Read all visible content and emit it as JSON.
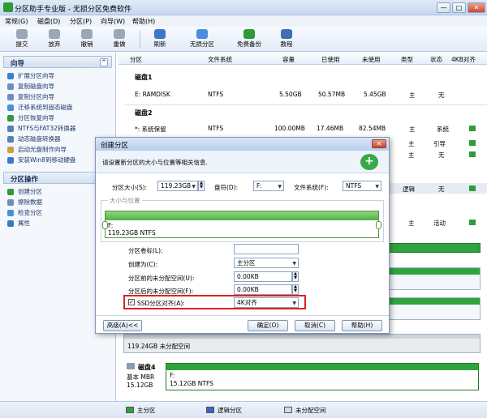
{
  "window": {
    "title": "分区助手专业版 - 无损分区免费软件",
    "min": "—",
    "max": "□",
    "close": "✕"
  },
  "menu": [
    "常规(G)",
    "磁盘(D)",
    "分区(P)",
    "向导(W)",
    "帮助(H)"
  ],
  "toolbar": [
    {
      "label": "提交",
      "icon": "commit-icon"
    },
    {
      "label": "放弃",
      "icon": "discard-icon"
    },
    {
      "label": "撤销",
      "icon": "undo-icon"
    },
    {
      "label": "重做",
      "icon": "redo-icon"
    },
    {
      "label": "刷新",
      "icon": "refresh-icon"
    },
    {
      "label": "无损分区",
      "icon": "partition-icon"
    },
    {
      "label": "免费备份",
      "icon": "backup-icon"
    },
    {
      "label": "教程",
      "icon": "tutorial-icon"
    }
  ],
  "wizard": {
    "title": "向导",
    "items": [
      "扩展分区向导",
      "复制磁盘向导",
      "复制分区向导",
      "迁移系统到固态磁盘",
      "分区恢复向导",
      "NTFS与FAT32转换器",
      "动态磁盘转换器",
      "启动光盘制作向导",
      "安装Win8到移动硬盘"
    ]
  },
  "ops": {
    "title": "分区操作",
    "items": [
      "创建分区",
      "擦除数据",
      "检查分区",
      "属性"
    ]
  },
  "columns": [
    "分区",
    "文件系统",
    "容量",
    "已使用",
    "未使用",
    "类型",
    "状态",
    "4KB对齐"
  ],
  "disk1": {
    "label": "磁盘1",
    "row": [
      "E: RAMDISK",
      "NTFS",
      "5.50GB",
      "50.57MB",
      "5.45GB",
      "主",
      "无"
    ]
  },
  "disk2": {
    "label": "磁盘2",
    "row": [
      "*: 系统保留",
      "NTFS",
      "100.00MB",
      "17.46MB",
      "82.54MB",
      "主",
      "系统"
    ]
  },
  "bg_rows": [
    {
      "type": "主",
      "status": "引导"
    },
    {
      "type": "主",
      "status": "无"
    },
    {
      "type": "逻辑",
      "status": "无"
    },
    {
      "type": "主",
      "status": "活动"
    }
  ],
  "dialog": {
    "title": "创建分区",
    "description": "请设置新分区的大小与位置等相关信息.",
    "size_label": "分区大小(S):",
    "size_value": "119.23GB",
    "drive_label": "盘符(D):",
    "drive_value": "F:",
    "fs_label": "文件系统(F):",
    "fs_value": "NTFS",
    "group_label": "大小与位置",
    "bar_label": "F:",
    "bar_sub": "119.23GB NTFS",
    "vol_label": "分区卷标(L):",
    "vol_value": "",
    "create_as_label": "创建为(C):",
    "create_as_value": "主分区",
    "before_label": "分区前的未分配空间(U):",
    "before_value": "0.00KB",
    "after_label": "分区后的未分配空间(F):",
    "after_value": "0.00KB",
    "ssd_label": "SSD分区对齐(A):",
    "ssd_checked": true,
    "ssd_value": "4K对齐",
    "advanced": "高级(A)<<",
    "ok": "确定(O)",
    "cancel": "取消(C)",
    "help": "帮助(H)"
  },
  "disk_area": {
    "unalloc_label": "119.24GB 未分配空间",
    "disk4_label": "磁盘4",
    "disk4_type": "基本 MBR",
    "disk4_size": "15.12GB",
    "disk4_part": "F:",
    "disk4_part_sub": "15.12GB NTFS"
  },
  "legend": [
    "主分区",
    "逻辑分区",
    "未分配空间"
  ],
  "colors": {
    "primary": "#2fa43e",
    "logical": "#3b62c9",
    "unalloc": "#d9d9d9",
    "highlight": "#e02020"
  }
}
